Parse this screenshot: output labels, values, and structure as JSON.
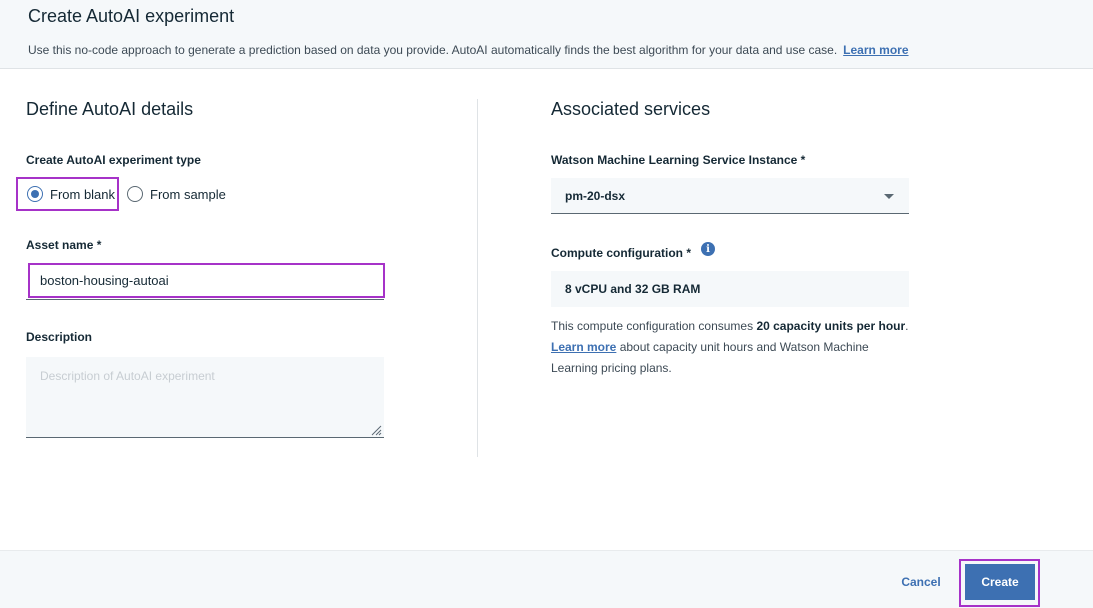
{
  "header": {
    "title": "Create AutoAI experiment",
    "description": "Use this no-code approach to generate a prediction based on data you provide.  AutoAI automatically finds the best algorithm for your data and use case.",
    "learn_more": "Learn more"
  },
  "left": {
    "section_title": "Define AutoAI details",
    "type_label": "Create AutoAI experiment type",
    "radio_blank": "From blank",
    "radio_sample": "From sample",
    "selected_type": "From blank",
    "asset_name_label": "Asset name *",
    "asset_name_value": "boston-housing-autoai",
    "description_label": "Description",
    "description_placeholder": "Description of AutoAI experiment"
  },
  "right": {
    "section_title": "Associated services",
    "wml_label": "Watson Machine Learning Service Instance *",
    "wml_value": "pm-20-dsx",
    "compute_label": "Compute configuration *",
    "compute_value": "8 vCPU and 32 GB RAM",
    "helper_prefix": "This compute configuration consumes ",
    "helper_bold": "20 capacity units per hour",
    "helper_mid": ". ",
    "helper_link": "Learn more",
    "helper_suffix": " about capacity unit hours and Watson Machine Learning pricing plans."
  },
  "footer": {
    "cancel_label": "Cancel",
    "create_label": "Create"
  },
  "colors": {
    "accent": "#3d70b2",
    "highlight": "#a632c8"
  }
}
